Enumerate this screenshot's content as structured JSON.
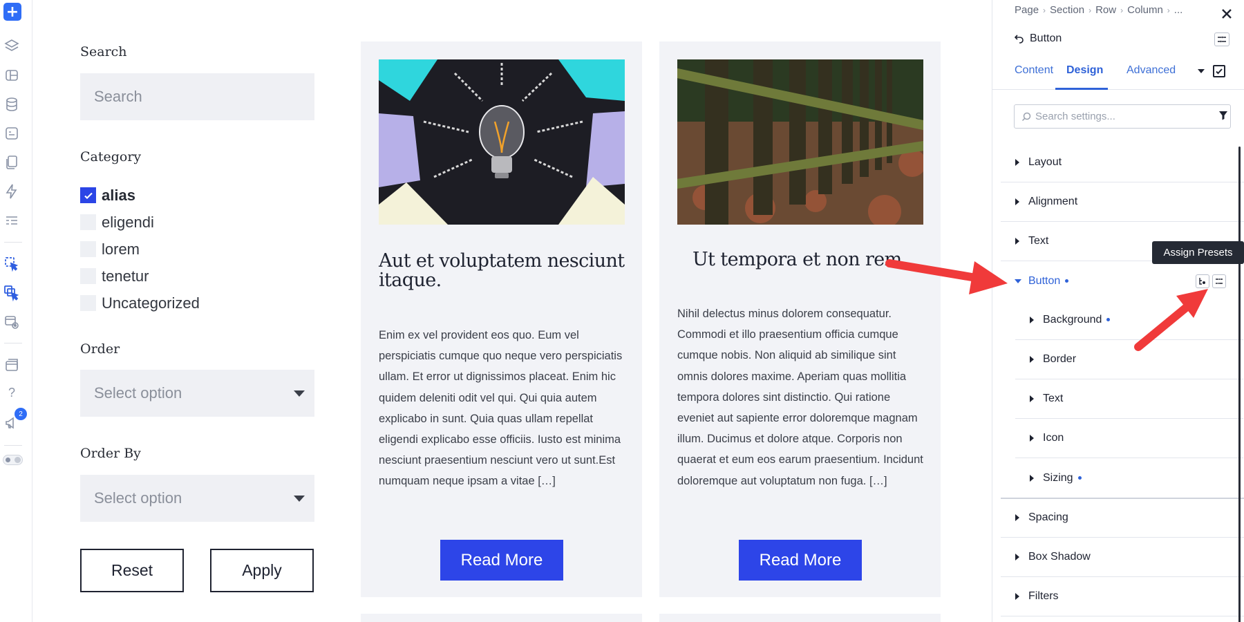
{
  "rail": {
    "icons": [
      "add-icon",
      "layers-icon",
      "layouts-icon",
      "database-icon",
      "modules-icon",
      "pages-icon",
      "lightning-icon",
      "list-icon",
      "click-cursor-icon",
      "multi-cursor-icon",
      "preview-icon",
      "templates-icon",
      "help-icon",
      "announcement-icon",
      "dark-mode-toggle-icon"
    ],
    "add_label": "+",
    "help_label": "?",
    "badge_count": "2"
  },
  "filters": {
    "search_label": "Search",
    "search_placeholder": "Search",
    "category_label": "Category",
    "categories": [
      {
        "label": "alias",
        "checked": true
      },
      {
        "label": "eligendi",
        "checked": false
      },
      {
        "label": "lorem",
        "checked": false
      },
      {
        "label": "tenetur",
        "checked": false
      },
      {
        "label": "Uncategorized",
        "checked": false
      }
    ],
    "order_label": "Order",
    "order_placeholder": "Select option",
    "order_by_label": "Order By",
    "order_by_placeholder": "Select option",
    "reset_label": "Reset",
    "apply_label": "Apply"
  },
  "posts": [
    {
      "title": "Aut et voluptatem nesciunt itaque.",
      "excerpt": "Enim ex vel provident eos quo. Eum vel perspiciatis cumque quo neque vero perspiciatis ullam. Et error ut dignissimos placeat. Enim hic quidem deleniti odit vel qui. Qui quia autem explicabo in sunt. Quia quas ullam repellat eligendi explicabo esse officiis. Iusto est minima nesciunt praesentium nesciunt vero ut sunt.Est numquam neque ipsam a vitae […]",
      "button": "Read More"
    },
    {
      "title": "Ut tempora et non rem.",
      "excerpt": "Nihil delectus minus dolorem consequatur. Commodi et illo praesentium officia cumque cumque nobis. Non aliquid ab similique sint omnis dolores maxime. Aperiam quas mollitia tempora dolores sint distinctio. Qui ratione eveniet aut sapiente error doloremque magnam illum. Ducimus et dolore atque. Corporis non quaerat et eum eos earum praesentium. Incidunt doloremque aut voluptatum non fuga. […]",
      "button": "Read More"
    }
  ],
  "panel": {
    "breadcrumb": [
      "Page",
      "Section",
      "Row",
      "Column",
      "..."
    ],
    "title": "Button",
    "tabs": [
      "Content",
      "Design",
      "Advanced"
    ],
    "active_tab": "Design",
    "search_placeholder": "Search settings...",
    "sections": [
      {
        "label": "Layout",
        "modified": false
      },
      {
        "label": "Alignment",
        "modified": false
      },
      {
        "label": "Text",
        "modified": false
      },
      {
        "label": "Button",
        "modified": true,
        "expanded": true
      },
      {
        "label": "Spacing",
        "modified": false
      },
      {
        "label": "Box Shadow",
        "modified": false
      },
      {
        "label": "Filters",
        "modified": false
      }
    ],
    "button_subsections": [
      {
        "label": "Background",
        "modified": true
      },
      {
        "label": "Border",
        "modified": false
      },
      {
        "label": "Text",
        "modified": false
      },
      {
        "label": "Icon",
        "modified": false
      },
      {
        "label": "Sizing",
        "modified": true
      }
    ],
    "tooltip": "Assign Presets"
  },
  "colors": {
    "accent": "#2f62d8",
    "read_more_bg": "#2d45e8",
    "checkbox_checked": "#2b45e6",
    "annotation_arrow": "#f03a3a"
  }
}
